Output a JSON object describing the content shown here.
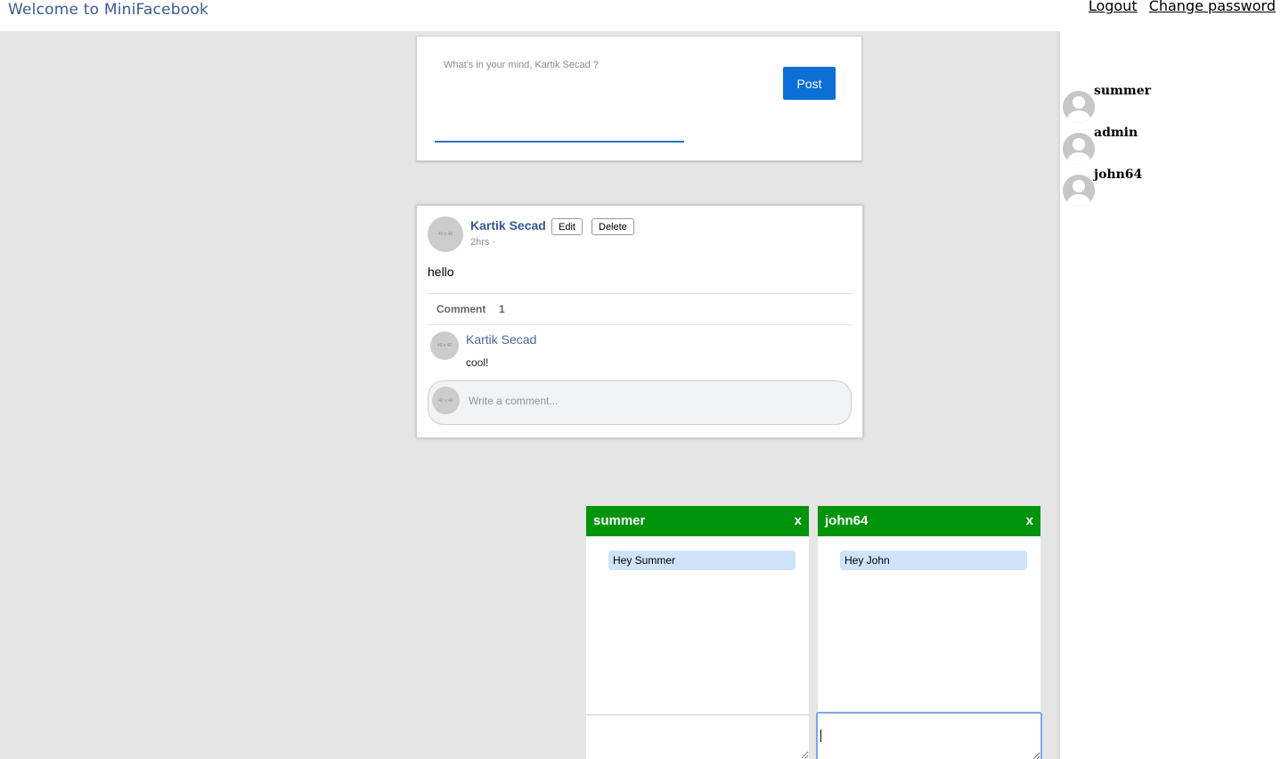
{
  "header": {
    "title": "Welcome to MiniFacebook",
    "logout_label": "Logout",
    "change_password_label": "Change password"
  },
  "composer": {
    "placeholder": "What's in your mind, Kartik Secad ?",
    "post_label": "Post"
  },
  "post": {
    "author": "Kartik Secad",
    "edit_label": "Edit",
    "delete_label": "Delete",
    "time": "2hrs ·",
    "text": "hello",
    "avatar_text": "40 x 40",
    "comment_tab_label": "Comment",
    "comment_count": "1",
    "comments": [
      {
        "author": "Kartik Secad",
        "text": "cool!",
        "avatar_text": "40 x 40"
      }
    ],
    "comment_placeholder": "Write a comment...",
    "comment_avatar_text": "40 x 40"
  },
  "sidebar": {
    "friends": [
      {
        "name": "summer"
      },
      {
        "name": "admin"
      },
      {
        "name": "john64"
      }
    ]
  },
  "chats": [
    {
      "title": "summer",
      "close_label": "x",
      "messages": [
        "Hey Summer"
      ]
    },
    {
      "title": "john64",
      "close_label": "x",
      "messages": [
        "Hey John"
      ]
    }
  ],
  "colors": {
    "header_accent": "#3b5998",
    "post_button": "#0a6fd6",
    "chat_header": "#00930c",
    "chat_bubble": "#cfe3fb",
    "page_background": "#e5e5e5"
  },
  "icons": {
    "friend_avatar": "user-silhouette-icon",
    "avatar_placeholder": "image-placeholder-icon"
  }
}
